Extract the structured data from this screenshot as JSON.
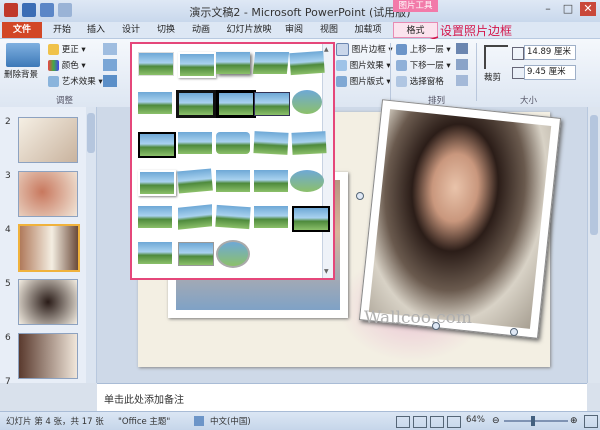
{
  "window": {
    "title": "演示文稿2 - Microsoft PowerPoint (试用版)",
    "minimize": "–",
    "maximize": "□",
    "close": "✕"
  },
  "context_tab_label": "图片工具",
  "tabs": [
    "文件",
    "开始",
    "插入",
    "设计",
    "切换",
    "动画",
    "幻灯片放映",
    "审阅",
    "视图",
    "加载项",
    "格式"
  ],
  "ribbon": {
    "remove_bg": "删除背景",
    "corrections": "更正",
    "color": "颜色",
    "artistic": "艺术效果",
    "adjust_group": "调整",
    "picture_border": "图片边框",
    "picture_effects": "图片效果",
    "picture_layout": "图片版式",
    "bring_forward": "上移一层",
    "send_backward": "下移一层",
    "selection_pane": "选择窗格",
    "arrange_group": "排列",
    "crop": "裁剪",
    "height": "14.89 厘米",
    "width": "9.45 厘米",
    "size_group": "大小"
  },
  "slides_pane": {
    "numbers": [
      "2",
      "3",
      "4",
      "5",
      "6",
      "7"
    ],
    "selected": "4"
  },
  "notes_placeholder": "单击此处添加备注",
  "watermark": "Wallcoo.com",
  "callout": "设置照片边框",
  "status": {
    "slide_info": "幻灯片 第 4 张，共 17 张",
    "theme": "\"Office 主题\"",
    "language": "中文(中国)",
    "zoom": "64%"
  },
  "colors": {
    "file_tab": "#d24726",
    "context_accent": "#f27aa9",
    "gallery_border": "#e5477a",
    "callout_text": "#d4164b"
  }
}
